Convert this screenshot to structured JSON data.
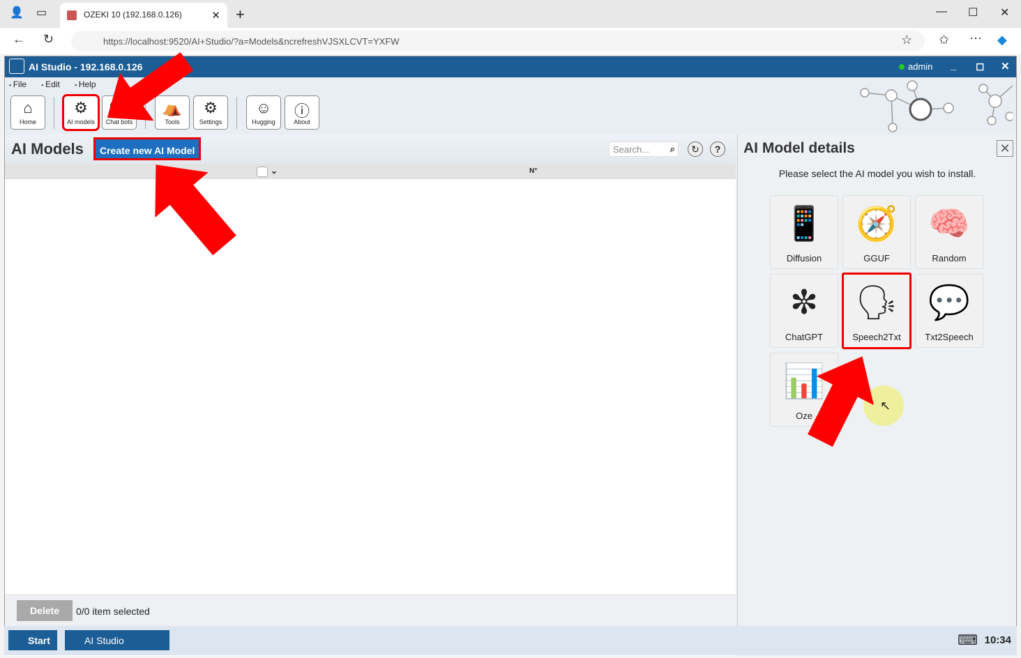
{
  "browser": {
    "tab_title": "OZEKI 10 (192.168.0.126)",
    "url": "https://localhost:9520/AI+Studio/?a=Models&ncrefreshVJSXLCVT=YXFW"
  },
  "app": {
    "title": "AI Studio - 192.168.0.126",
    "user": "admin",
    "menu": [
      "File",
      "Edit",
      "Help"
    ],
    "toolbar": [
      {
        "label": "Home",
        "icon": "home-icon"
      },
      {
        "label": "AI models",
        "icon": "gear-brain-icon"
      },
      {
        "label": "Chat bots",
        "icon": "chat-icon"
      },
      {
        "label": "Tools",
        "icon": "tools-icon"
      },
      {
        "label": "Settings",
        "icon": "gear-icon"
      },
      {
        "label": "Hugging",
        "icon": "hugging-face-icon"
      },
      {
        "label": "About",
        "icon": "info-icon"
      }
    ]
  },
  "left": {
    "title": "AI Models",
    "create_label": "Create new AI Model",
    "search_placeholder": "Search...",
    "col_no": "N°",
    "delete_label": "Delete",
    "selection_status": "0/0 item selected"
  },
  "right": {
    "title": "AI Model details",
    "message": "Please select the AI model you wish to install.",
    "models": [
      {
        "label": "Diffusion",
        "icon": "📱"
      },
      {
        "label": "GGUF",
        "icon": "🧭"
      },
      {
        "label": "Random",
        "icon": "🧠"
      },
      {
        "label": "ChatGPT",
        "icon": "✼"
      },
      {
        "label": "Speech2Txt",
        "icon": "🗣"
      },
      {
        "label": "Txt2Speech",
        "icon": "💬"
      },
      {
        "label": "Oze",
        "icon": "📊"
      }
    ]
  },
  "taskbar": {
    "start": "Start",
    "task": "AI Studio",
    "time": "10:34"
  },
  "colors": {
    "accent": "#1c5d95",
    "highlight": "#e00000",
    "button": "#1e6fc0"
  }
}
